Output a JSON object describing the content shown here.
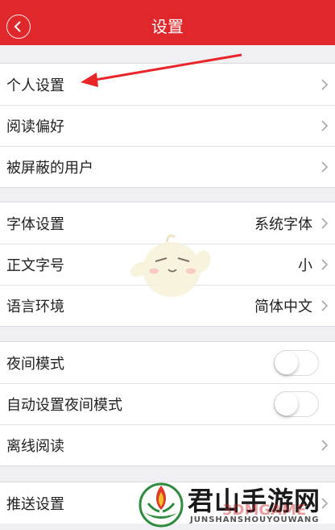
{
  "header": {
    "title": "设置",
    "back_icon": "chevron-left-icon"
  },
  "groups": [
    {
      "items": [
        {
          "label": "个人设置"
        },
        {
          "label": "阅读偏好"
        },
        {
          "label": "被屏蔽的用户"
        }
      ]
    },
    {
      "items": [
        {
          "label": "字体设置",
          "value": "系统字体"
        },
        {
          "label": "正文字号",
          "value": "小"
        },
        {
          "label": "语言环境",
          "value": "简体中文"
        }
      ]
    },
    {
      "items": [
        {
          "label": "夜间模式",
          "toggle": false
        },
        {
          "label": "自动设置夜间模式",
          "toggle": false
        },
        {
          "label": "离线阅读"
        }
      ]
    },
    {
      "items": [
        {
          "label": "推送设置"
        }
      ]
    }
  ],
  "watermark": {
    "name": "君山手游网",
    "sub": "JUNSHANSHOUYOUWANG",
    "ghost": "3DMGAME"
  },
  "colors": {
    "brand": "#e0272c",
    "background": "#efeff4"
  }
}
